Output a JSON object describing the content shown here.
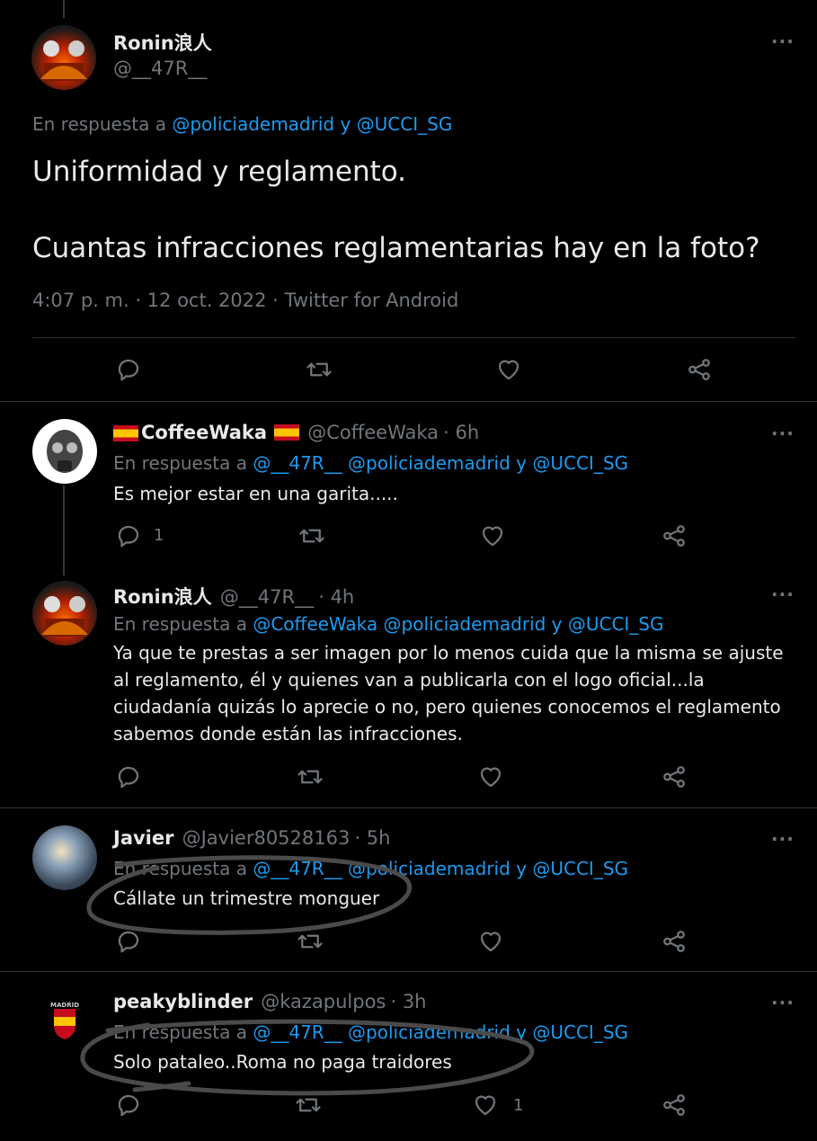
{
  "main_tweet": {
    "name": "Ronin浪人",
    "handle": "@__47R__",
    "reply_label": "En respuesta a",
    "reply_mentions": "@policiademadrid y @UCCI_SG",
    "line1": "Uniformidad y reglamento.",
    "line2": "Cuantas infracciones reglamentarias hay en la foto?",
    "meta": "4:07 p. m. · 12 oct. 2022 · Twitter for Android",
    "more": "···"
  },
  "replies": [
    {
      "name": "CoffeeWaka",
      "handle": "@CoffeeWaka",
      "time": "· 6h",
      "reply_label": "En respuesta a",
      "reply_mentions": "@__47R__ @policiademadrid y @UCCI_SG",
      "text": "Es mejor estar en una garita.....",
      "reply_count": "1",
      "like_count": ""
    },
    {
      "name": "Ronin浪人",
      "handle": "@__47R__",
      "time": "· 4h",
      "reply_label": "En respuesta a",
      "reply_mentions": "@CoffeeWaka @policiademadrid y @UCCI_SG",
      "text": "Ya que te prestas a ser imagen por lo menos cuida que la misma se ajuste al reglamento, él y quienes van a publicarla con el logo oficial...la ciudadanía quizás lo aprecie o no, pero quienes conocemos el reglamento sabemos donde están las infracciones.",
      "reply_count": "",
      "like_count": ""
    },
    {
      "name": "Javier",
      "handle": "@Javier80528163",
      "time": "· 5h",
      "reply_label": "En respuesta a",
      "reply_mentions": "@__47R__ @policiademadrid y @UCCI_SG",
      "text": "Cállate un trimestre monguer",
      "reply_count": "",
      "like_count": ""
    },
    {
      "name": "peakyblinder",
      "handle": "@kazapulpos",
      "time": "· 3h",
      "reply_label": "En respuesta a",
      "reply_mentions": "@__47R__ @policiademadrid y @UCCI_SG",
      "text": "Solo pataleo..Roma no paga traidores",
      "reply_count": "",
      "like_count": "1",
      "avatar_text": "MADRID"
    }
  ],
  "icons": [
    "reply-icon",
    "retweet-icon",
    "like-icon",
    "share-icon",
    "more-icon"
  ]
}
